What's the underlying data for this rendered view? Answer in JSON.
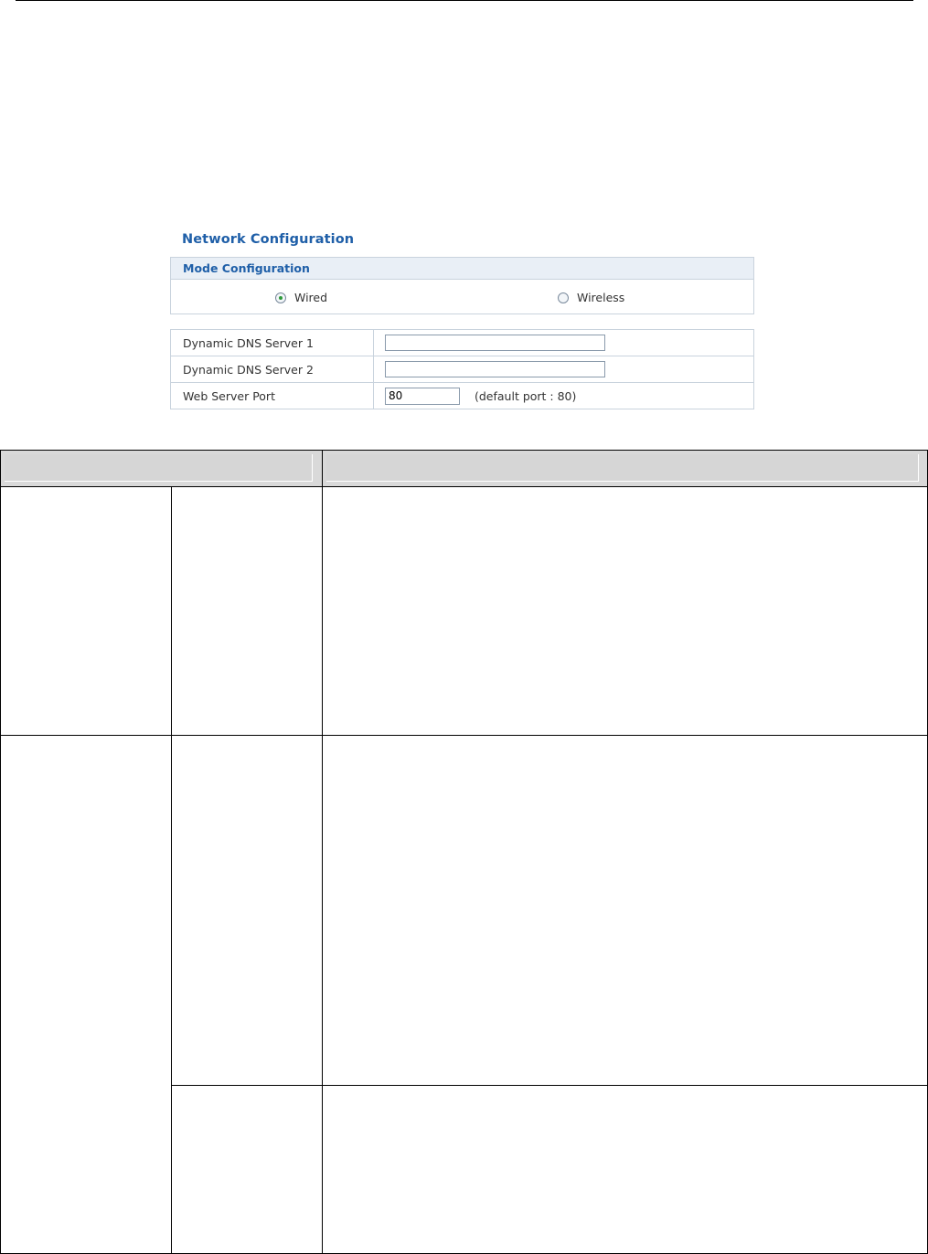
{
  "network_config": {
    "title": "Network Configuration",
    "mode": {
      "header": "Mode Configuration",
      "options": [
        {
          "label": "Wired",
          "selected": true
        },
        {
          "label": "Wireless",
          "selected": false
        }
      ]
    },
    "rows": [
      {
        "label": "Dynamic DNS Server 1",
        "value": ""
      },
      {
        "label": "Dynamic DNS Server 2",
        "value": ""
      },
      {
        "label": "Web Server Port",
        "value": "80",
        "hint": "(default port : 80)"
      }
    ]
  },
  "colors": {
    "title_blue": "#1f5fa8",
    "header_bg": "#e9eff6",
    "border": "#c9d3dd",
    "radio_dot": "#2e9a3a",
    "table_header_gray": "#d9d9d9"
  }
}
